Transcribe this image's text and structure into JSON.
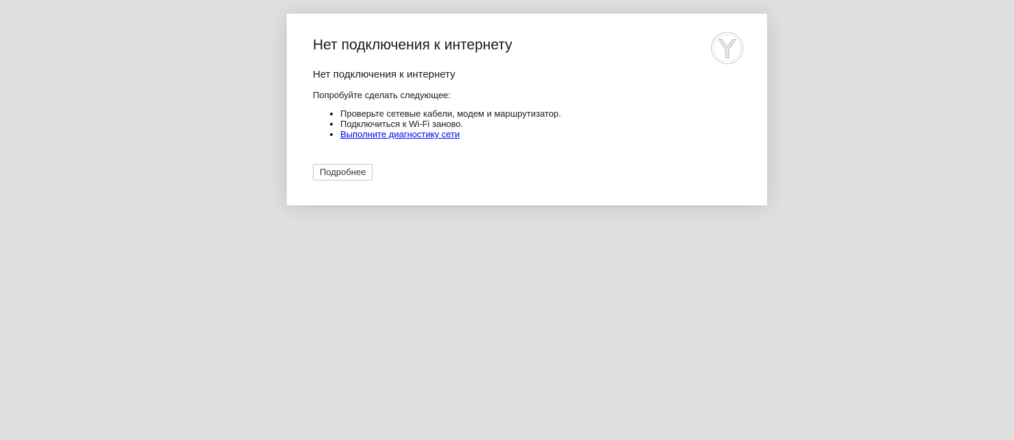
{
  "page": {
    "title": "Нет подключения к интернету",
    "subtitle": "Нет подключения к интернету",
    "hint": "Попробуйте сделать следующее:",
    "tips": [
      "Проверьте сетевые кабели, модем и маршрутизатор.",
      "Подключиться к Wi-Fi заново."
    ],
    "diagnostics_link": "Выполните диагностику сети",
    "details_button": "Подробнее"
  },
  "logo": {
    "icon": "yandex-browser-icon"
  },
  "colors": {
    "background": "#e0e0e0",
    "card": "#ffffff",
    "link": "#0000ee",
    "text": "#1a1a1a"
  }
}
